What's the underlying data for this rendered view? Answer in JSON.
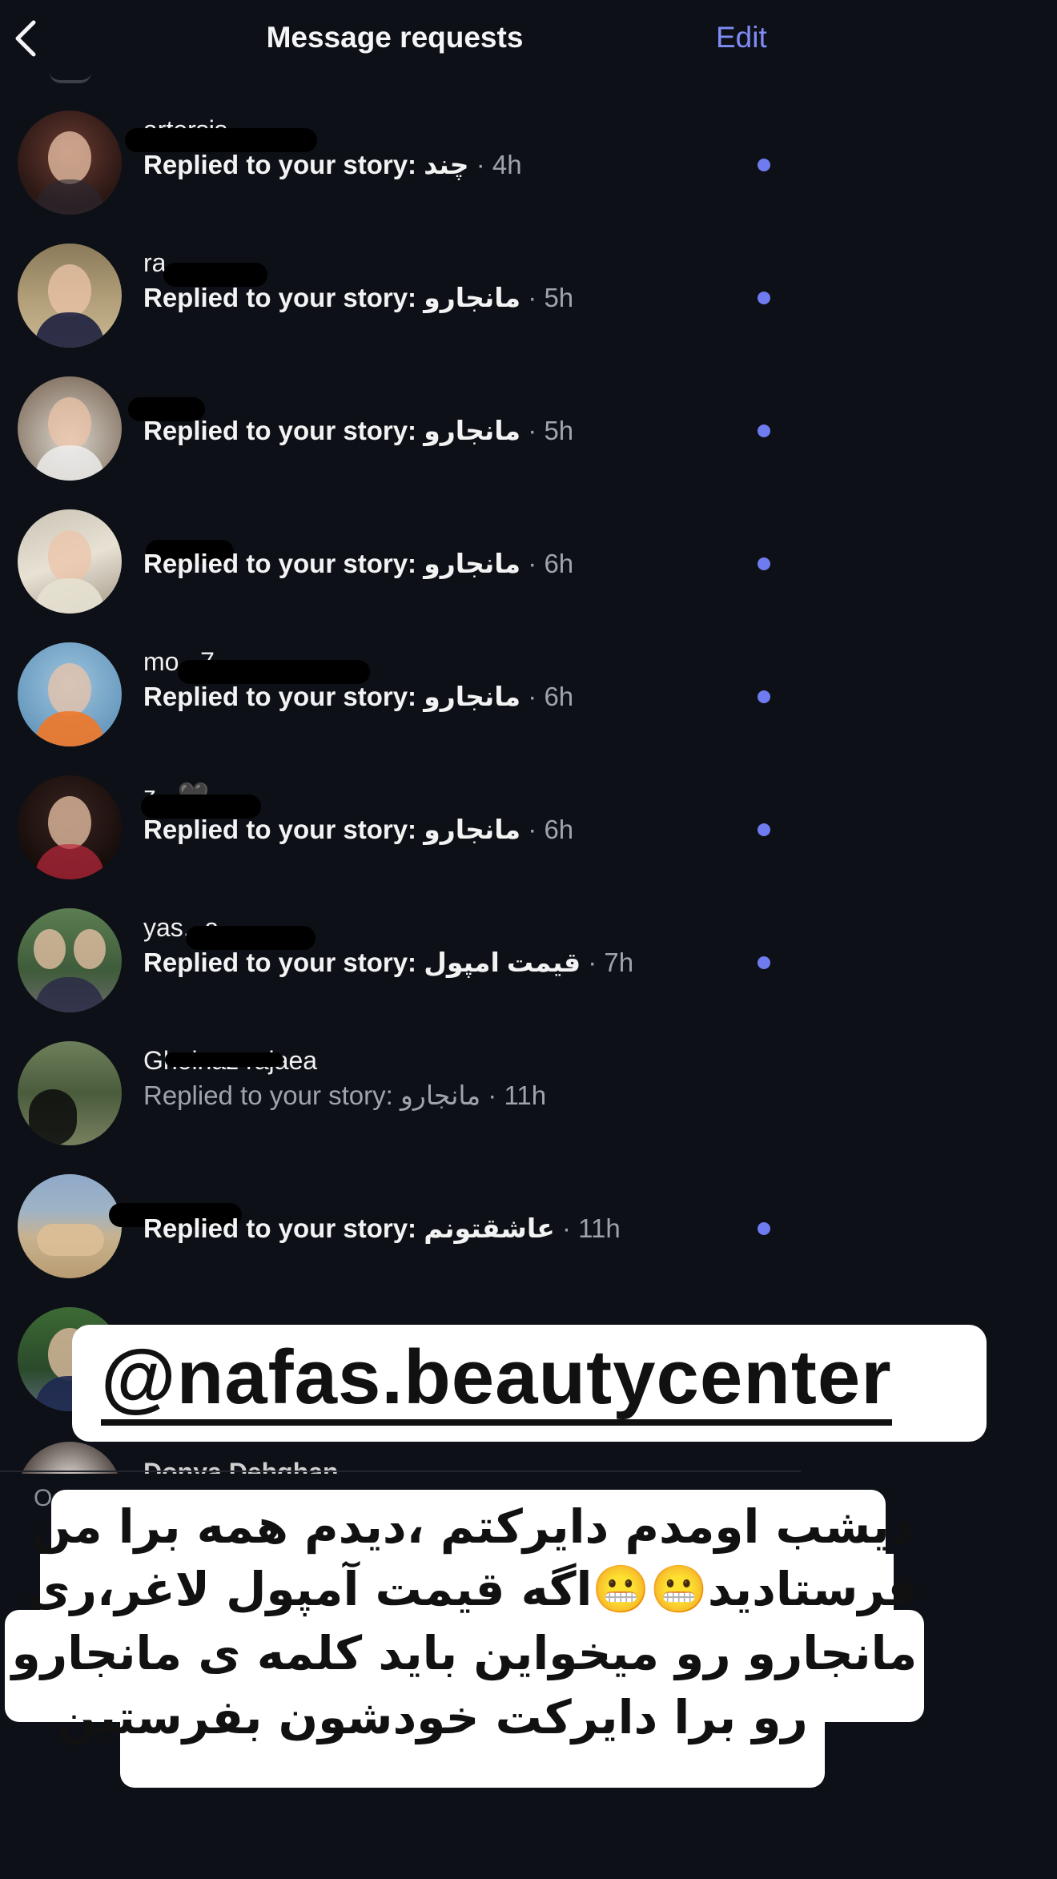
{
  "header": {
    "title": "Message requests",
    "edit_label": "Edit"
  },
  "requests": [
    {
      "username": "artersis...",
      "text": "Replied to your story: چند",
      "time": " · 4h",
      "unread": true
    },
    {
      "username": "ra...",
      "text": "Replied to your story: مانجارو",
      "time": " · 5h",
      "unread": true
    },
    {
      "username": "",
      "text": "Replied to your story: مانجارو",
      "time": " · 5h",
      "unread": true
    },
    {
      "username": "",
      "text": "Replied to your story: مانجارو",
      "time": " · 6h",
      "unread": true
    },
    {
      "username": "mo...7",
      "text": "Replied to your story: مانجارو",
      "time": " · 6h",
      "unread": true
    },
    {
      "username": "z...🖤",
      "text": "Replied to your story: مانجارو",
      "time": " · 6h",
      "unread": true
    },
    {
      "username": "yas...a",
      "text": "Replied to your story: قیمت امپول",
      "time": " · 7h",
      "unread": true
    },
    {
      "username": "Gholnaz rajaea",
      "text": "Replied to your story: مانجارو",
      "time": " · 11h",
      "unread": false
    },
    {
      "username": "",
      "text": "Replied to your story: عاشقتونم",
      "time": " · 11h",
      "unread": true
    }
  ],
  "partial_request": {
    "username": "Donya Dehghan"
  },
  "footer_letter": "O",
  "overlay": {
    "handle": "@nafas.beautycenter",
    "story_lines": [
      "دیشب اومدم دایرکتم ،دیدم همه برا من",
      "فرستادید😬😬اگه قیمت آمپول لاغر،ری",
      "مانجارو رو میخواین باید کلمه ی  مانجارو",
      "رو برا دایرکت خودشون بفرستین"
    ]
  },
  "colors": {
    "background": "#0d1016",
    "accent": "#7f8cf5",
    "unread_dot": "#6f7cf0"
  },
  "icons": {
    "back": "chevron-left-icon",
    "unread": "unread-dot-icon"
  }
}
